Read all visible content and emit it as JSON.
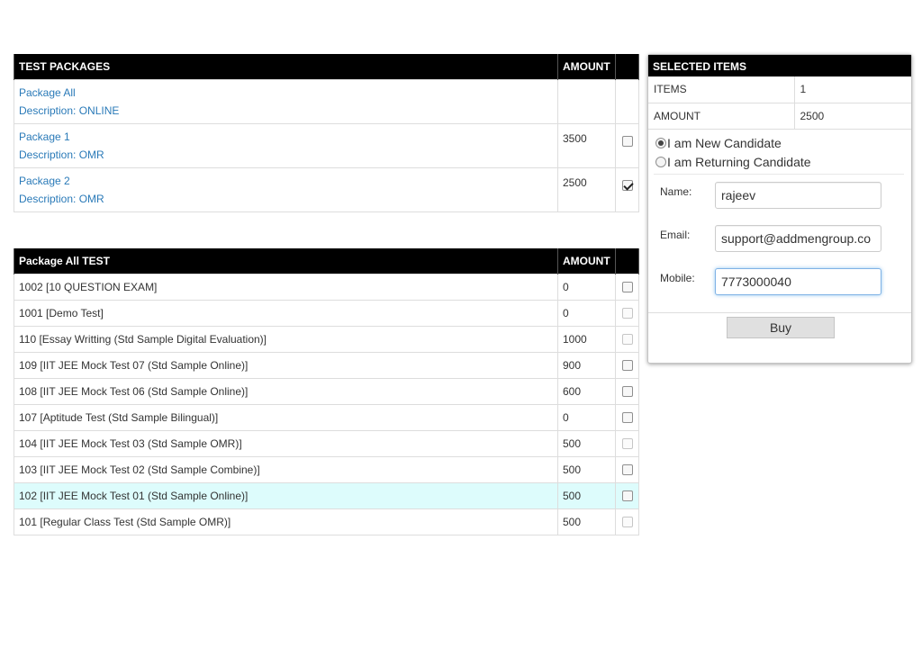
{
  "packages": {
    "headers": {
      "name": "TEST PACKAGES",
      "amount": "AMOUNT"
    },
    "rows": [
      {
        "name": "Package All",
        "description": "Description: ONLINE",
        "amount": "",
        "checkbox": "none"
      },
      {
        "name": "Package 1",
        "description": "Description: OMR",
        "amount": "3500",
        "checkbox": "unchecked"
      },
      {
        "name": "Package 2",
        "description": "Description: OMR",
        "amount": "2500",
        "checkbox": "checked"
      }
    ]
  },
  "tests": {
    "headers": {
      "name": "Package All TEST",
      "amount": "AMOUNT"
    },
    "rows": [
      {
        "name": "1002 [10 QUESTION EXAM]",
        "amount": "0",
        "checkbox": "enabled"
      },
      {
        "name": "1001 [Demo Test]",
        "amount": "0",
        "checkbox": "disabled"
      },
      {
        "name": "110 [Essay Writting (Std Sample Digital Evaluation)]",
        "amount": "1000",
        "checkbox": "disabled"
      },
      {
        "name": "109 [IIT JEE Mock Test 07 (Std Sample Online)]",
        "amount": "900",
        "checkbox": "enabled"
      },
      {
        "name": "108 [IIT JEE Mock Test 06 (Std Sample Online)]",
        "amount": "600",
        "checkbox": "enabled"
      },
      {
        "name": "107 [Aptitude Test (Std Sample Bilingual)]",
        "amount": "0",
        "checkbox": "enabled"
      },
      {
        "name": "104 [IIT JEE Mock Test 03 (Std Sample OMR)]",
        "amount": "500",
        "checkbox": "disabled"
      },
      {
        "name": "103 [IIT JEE Mock Test 02 (Std Sample Combine)]",
        "amount": "500",
        "checkbox": "enabled"
      },
      {
        "name": "102 [IIT JEE Mock Test 01 (Std Sample Online)]",
        "amount": "500",
        "checkbox": "enabled",
        "highlighted": true
      },
      {
        "name": "101 [Regular Class Test (Std Sample OMR)]",
        "amount": "500",
        "checkbox": "disabled"
      }
    ]
  },
  "selected": {
    "title": "SELECTED ITEMS",
    "items_label": "ITEMS",
    "items_value": "1",
    "amount_label": "AMOUNT",
    "amount_value": "2500",
    "radio_new": "I am New Candidate",
    "radio_returning": "I am Returning Candidate",
    "selected_radio": "new",
    "name_label": "Name:",
    "name_value": "rajeev",
    "email_label": "Email:",
    "email_value": "support@addmengroup.co",
    "mobile_label": "Mobile:",
    "mobile_value": "7773000040",
    "buy_label": "Buy"
  },
  "colors": {
    "header_bg": "#000000",
    "link": "#2a7ab8",
    "highlight_row": "#ddfcfc"
  }
}
